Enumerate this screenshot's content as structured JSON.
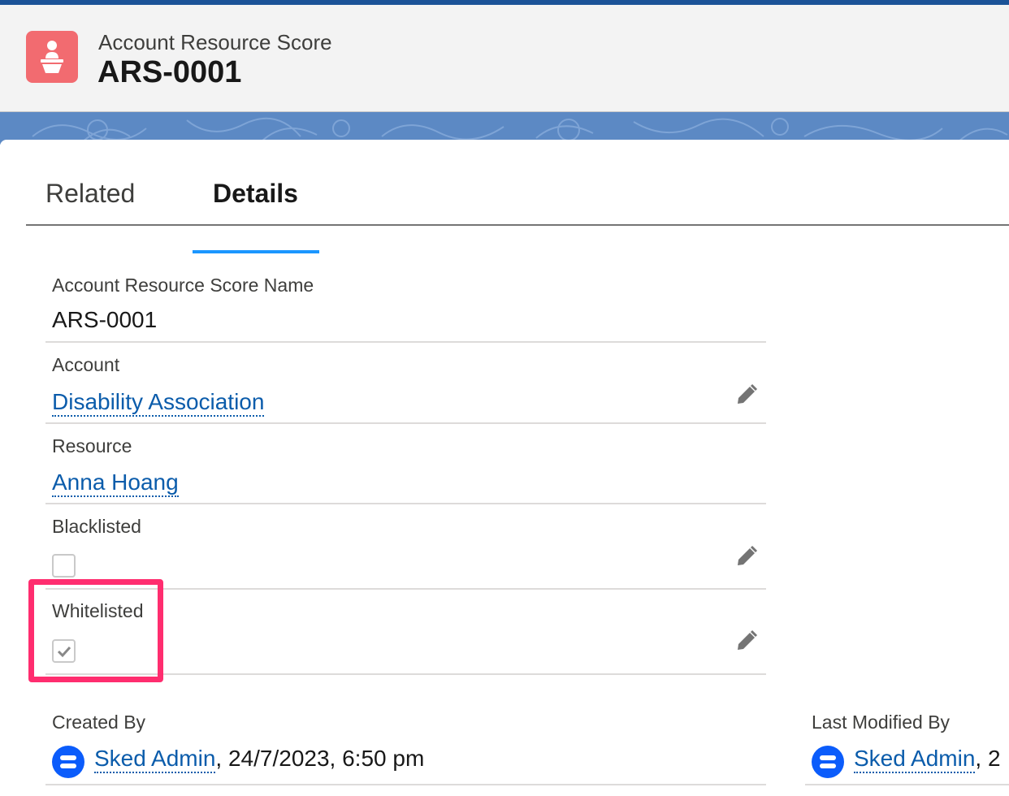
{
  "header": {
    "object_type": "Account Resource Score",
    "record_name": "ARS-0001",
    "icon": "person-podium-icon"
  },
  "tabs": [
    {
      "label": "Related",
      "active": false
    },
    {
      "label": "Details",
      "active": true
    }
  ],
  "fields": {
    "name": {
      "label": "Account Resource Score Name",
      "value": "ARS-0001"
    },
    "account": {
      "label": "Account",
      "value": "Disability Association"
    },
    "resource": {
      "label": "Resource",
      "value": "Anna Hoang"
    },
    "blacklisted": {
      "label": "Blacklisted",
      "checked": false
    },
    "whitelisted": {
      "label": "Whitelisted",
      "checked": true
    }
  },
  "audit": {
    "created_by": {
      "label": "Created By",
      "user": "Sked Admin",
      "suffix": ", 24/7/2023, 6:50 pm"
    },
    "last_modified_by": {
      "label": "Last Modified By",
      "user": "Sked Admin",
      "suffix": ", 2"
    }
  },
  "colors": {
    "icon_bg": "#f26b70",
    "link": "#0b5cab",
    "tab_active": "#1b96ff",
    "highlight": "#ff2d6f",
    "avatar": "#0b5cfb"
  }
}
